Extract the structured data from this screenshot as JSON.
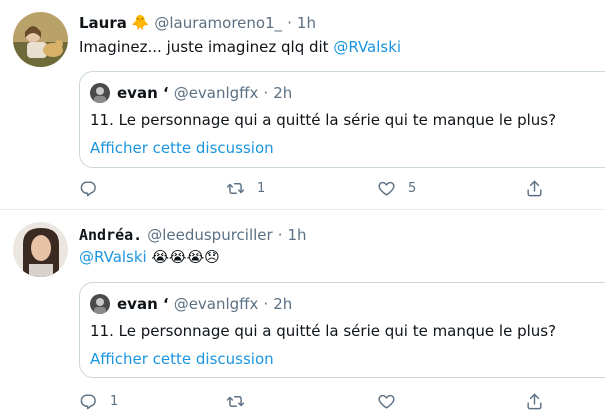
{
  "tweets": [
    {
      "name": "Laura",
      "name_emoji": "🐥",
      "handle": "@lauramoreno1_",
      "separator": "·",
      "time": "1h",
      "text_emoji": "",
      "text": "Imaginez... juste imaginez qlq dit",
      "mention": "@RValski",
      "quote": {
        "name": "evan ‘",
        "handle": "@evanlgffx",
        "separator": "·",
        "time": "2h",
        "text": "11. Le personnage qui a quitté la série qui te manque le plus?",
        "link": "Afficher cette discussion"
      },
      "actions": {
        "replies": "",
        "retweets": "1",
        "likes": "5"
      }
    },
    {
      "name": "Andréa.",
      "name_emoji": "",
      "handle": "@leeduspurciller",
      "separator": "·",
      "time": "1h",
      "text": "",
      "mention": "@RValski",
      "text_emoji": "😭😭😭😞",
      "quote": {
        "name": "evan ‘",
        "handle": "@evanlgffx",
        "separator": "·",
        "time": "2h",
        "text": "11. Le personnage qui a quitté la série qui te manque le plus?",
        "link": "Afficher cette discussion"
      },
      "actions": {
        "replies": "1",
        "retweets": "",
        "likes": ""
      }
    }
  ],
  "icons": [
    "reply-icon",
    "retweet-icon",
    "like-icon",
    "share-icon"
  ],
  "colors": {
    "link": "#1b95e0",
    "muted": "#5b7083",
    "border": "#ccd6dd",
    "divider": "#e6ecf0"
  }
}
